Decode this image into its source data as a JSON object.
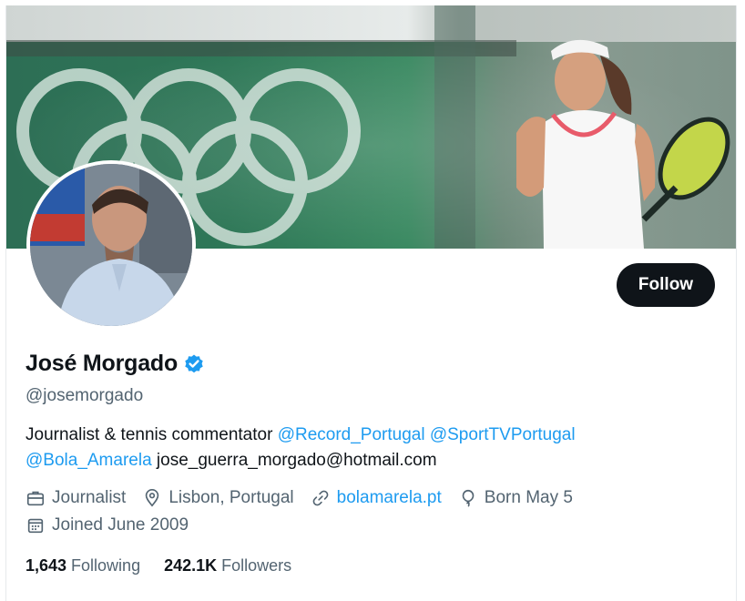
{
  "profile": {
    "display_name": "José Morgado",
    "handle": "@josemorgado",
    "bio_text": "Journalist & tennis commentator",
    "bio_mentions": [
      "@Record_Portugal",
      "@SportTVPortugal",
      "@Bola_Amarela"
    ],
    "bio_email": "jose_guerra_morgado@hotmail.com",
    "verified_icon": "verified-badge-icon",
    "accent_color": "#1d9bf0"
  },
  "actions": {
    "follow_label": "Follow"
  },
  "meta": {
    "profession": "Journalist",
    "location": "Lisbon, Portugal",
    "website": "bolamarela.pt",
    "birthday": "Born May 5",
    "joined": "Joined June 2009"
  },
  "stats": {
    "following_count": "1,643",
    "following_label": "Following",
    "followers_count": "242.1K",
    "followers_label": "Followers"
  }
}
